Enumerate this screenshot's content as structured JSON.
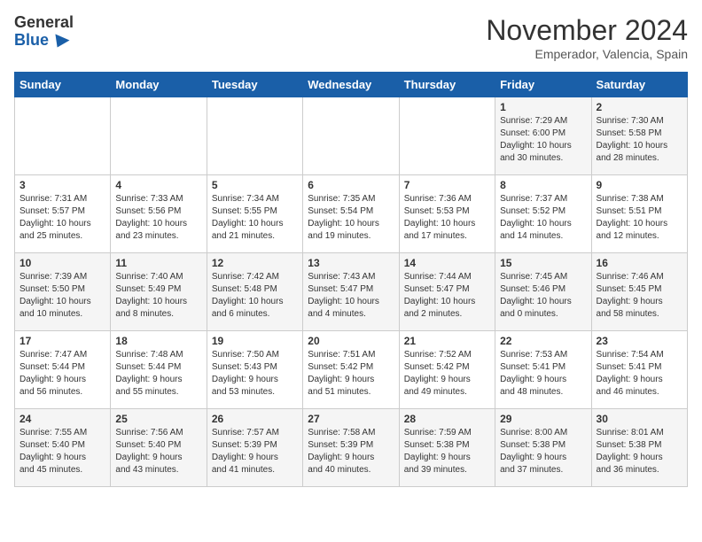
{
  "header": {
    "logo_general": "General",
    "logo_blue": "Blue",
    "month": "November 2024",
    "location": "Emperador, Valencia, Spain"
  },
  "weekdays": [
    "Sunday",
    "Monday",
    "Tuesday",
    "Wednesday",
    "Thursday",
    "Friday",
    "Saturday"
  ],
  "weeks": [
    [
      {
        "day": "",
        "info": ""
      },
      {
        "day": "",
        "info": ""
      },
      {
        "day": "",
        "info": ""
      },
      {
        "day": "",
        "info": ""
      },
      {
        "day": "",
        "info": ""
      },
      {
        "day": "1",
        "info": "Sunrise: 7:29 AM\nSunset: 6:00 PM\nDaylight: 10 hours\nand 30 minutes."
      },
      {
        "day": "2",
        "info": "Sunrise: 7:30 AM\nSunset: 5:58 PM\nDaylight: 10 hours\nand 28 minutes."
      }
    ],
    [
      {
        "day": "3",
        "info": "Sunrise: 7:31 AM\nSunset: 5:57 PM\nDaylight: 10 hours\nand 25 minutes."
      },
      {
        "day": "4",
        "info": "Sunrise: 7:33 AM\nSunset: 5:56 PM\nDaylight: 10 hours\nand 23 minutes."
      },
      {
        "day": "5",
        "info": "Sunrise: 7:34 AM\nSunset: 5:55 PM\nDaylight: 10 hours\nand 21 minutes."
      },
      {
        "day": "6",
        "info": "Sunrise: 7:35 AM\nSunset: 5:54 PM\nDaylight: 10 hours\nand 19 minutes."
      },
      {
        "day": "7",
        "info": "Sunrise: 7:36 AM\nSunset: 5:53 PM\nDaylight: 10 hours\nand 17 minutes."
      },
      {
        "day": "8",
        "info": "Sunrise: 7:37 AM\nSunset: 5:52 PM\nDaylight: 10 hours\nand 14 minutes."
      },
      {
        "day": "9",
        "info": "Sunrise: 7:38 AM\nSunset: 5:51 PM\nDaylight: 10 hours\nand 12 minutes."
      }
    ],
    [
      {
        "day": "10",
        "info": "Sunrise: 7:39 AM\nSunset: 5:50 PM\nDaylight: 10 hours\nand 10 minutes."
      },
      {
        "day": "11",
        "info": "Sunrise: 7:40 AM\nSunset: 5:49 PM\nDaylight: 10 hours\nand 8 minutes."
      },
      {
        "day": "12",
        "info": "Sunrise: 7:42 AM\nSunset: 5:48 PM\nDaylight: 10 hours\nand 6 minutes."
      },
      {
        "day": "13",
        "info": "Sunrise: 7:43 AM\nSunset: 5:47 PM\nDaylight: 10 hours\nand 4 minutes."
      },
      {
        "day": "14",
        "info": "Sunrise: 7:44 AM\nSunset: 5:47 PM\nDaylight: 10 hours\nand 2 minutes."
      },
      {
        "day": "15",
        "info": "Sunrise: 7:45 AM\nSunset: 5:46 PM\nDaylight: 10 hours\nand 0 minutes."
      },
      {
        "day": "16",
        "info": "Sunrise: 7:46 AM\nSunset: 5:45 PM\nDaylight: 9 hours\nand 58 minutes."
      }
    ],
    [
      {
        "day": "17",
        "info": "Sunrise: 7:47 AM\nSunset: 5:44 PM\nDaylight: 9 hours\nand 56 minutes."
      },
      {
        "day": "18",
        "info": "Sunrise: 7:48 AM\nSunset: 5:44 PM\nDaylight: 9 hours\nand 55 minutes."
      },
      {
        "day": "19",
        "info": "Sunrise: 7:50 AM\nSunset: 5:43 PM\nDaylight: 9 hours\nand 53 minutes."
      },
      {
        "day": "20",
        "info": "Sunrise: 7:51 AM\nSunset: 5:42 PM\nDaylight: 9 hours\nand 51 minutes."
      },
      {
        "day": "21",
        "info": "Sunrise: 7:52 AM\nSunset: 5:42 PM\nDaylight: 9 hours\nand 49 minutes."
      },
      {
        "day": "22",
        "info": "Sunrise: 7:53 AM\nSunset: 5:41 PM\nDaylight: 9 hours\nand 48 minutes."
      },
      {
        "day": "23",
        "info": "Sunrise: 7:54 AM\nSunset: 5:41 PM\nDaylight: 9 hours\nand 46 minutes."
      }
    ],
    [
      {
        "day": "24",
        "info": "Sunrise: 7:55 AM\nSunset: 5:40 PM\nDaylight: 9 hours\nand 45 minutes."
      },
      {
        "day": "25",
        "info": "Sunrise: 7:56 AM\nSunset: 5:40 PM\nDaylight: 9 hours\nand 43 minutes."
      },
      {
        "day": "26",
        "info": "Sunrise: 7:57 AM\nSunset: 5:39 PM\nDaylight: 9 hours\nand 41 minutes."
      },
      {
        "day": "27",
        "info": "Sunrise: 7:58 AM\nSunset: 5:39 PM\nDaylight: 9 hours\nand 40 minutes."
      },
      {
        "day": "28",
        "info": "Sunrise: 7:59 AM\nSunset: 5:38 PM\nDaylight: 9 hours\nand 39 minutes."
      },
      {
        "day": "29",
        "info": "Sunrise: 8:00 AM\nSunset: 5:38 PM\nDaylight: 9 hours\nand 37 minutes."
      },
      {
        "day": "30",
        "info": "Sunrise: 8:01 AM\nSunset: 5:38 PM\nDaylight: 9 hours\nand 36 minutes."
      }
    ]
  ]
}
